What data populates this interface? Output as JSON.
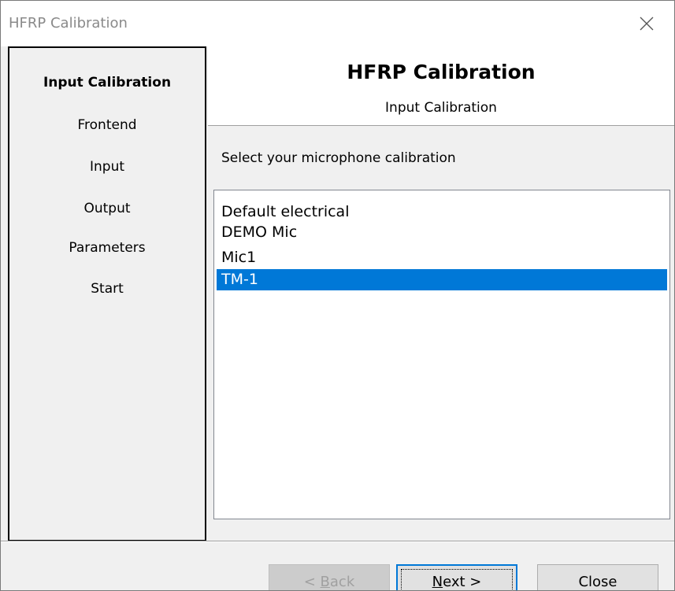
{
  "window": {
    "title": "HFRP Calibration"
  },
  "sidebar": {
    "items": [
      {
        "label": "Input Calibration",
        "active": true
      },
      {
        "label": "Frontend",
        "active": false
      },
      {
        "label": "Input",
        "active": false
      },
      {
        "label": "Output",
        "active": false
      },
      {
        "label": "Parameters",
        "active": false
      },
      {
        "label": "Start",
        "active": false
      }
    ]
  },
  "header": {
    "title": "HFRP Calibration",
    "subtitle": "Input Calibration"
  },
  "main": {
    "prompt": "Select your microphone calibration",
    "list": {
      "items": [
        "Default electrical",
        "DEMO Mic",
        "Mic1",
        "TM-1"
      ],
      "selected": "TM-1"
    }
  },
  "buttons": {
    "back": {
      "prefix": "< ",
      "mnemonic": "B",
      "rest": "ack",
      "enabled": false
    },
    "next": {
      "mnemonic": "N",
      "rest": "ext >"
    },
    "close": "Close"
  },
  "colors": {
    "selection": "#0078d7",
    "window_bg": "#f0f0f0"
  },
  "icons": {
    "close": "close-icon"
  }
}
